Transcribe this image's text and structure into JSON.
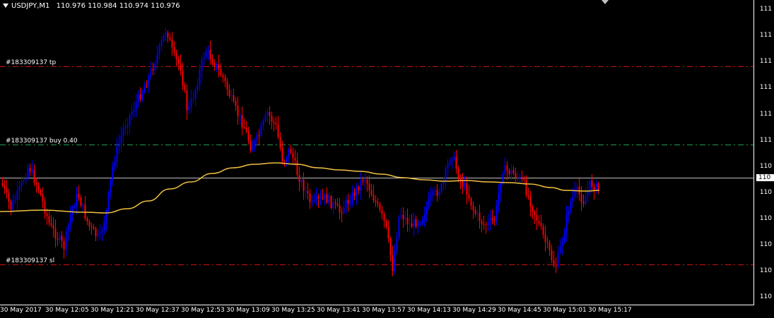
{
  "header": {
    "symbol": "USDJPY,M1",
    "open": "110.976",
    "high": "110.984",
    "low": "110.974",
    "close": "110.976"
  },
  "colors": {
    "bull": "#0000ff",
    "bear": "#ff0000",
    "ma": "#f0c040",
    "tp_line": "#d01010",
    "sl_line": "#d01010",
    "entry_line": "#20a050",
    "current_line": "#c0c0c0"
  },
  "trade_lines": [
    {
      "id": "tp",
      "label": "#183309137 tp"
    },
    {
      "id": "entry",
      "label": "#183309137 buy 0.40"
    },
    {
      "id": "sl",
      "label": "#183309137 sl"
    }
  ],
  "price_axis_labels": [
    "111",
    "111",
    "111",
    "111",
    "111",
    "111",
    "110",
    "110",
    "110",
    "110",
    "110",
    "110"
  ],
  "current_price_label": "110",
  "time_axis_labels": [
    "30 May 2017",
    "30 May 12:05",
    "30 May 12:21",
    "30 May 12:37",
    "30 May 12:53",
    "30 May 13:09",
    "30 May 13:25",
    "30 May 13:41",
    "30 May 13:57",
    "30 May 14:13",
    "30 May 14:29",
    "30 May 14:45",
    "30 May 15:01",
    "30 May 15:17"
  ]
}
